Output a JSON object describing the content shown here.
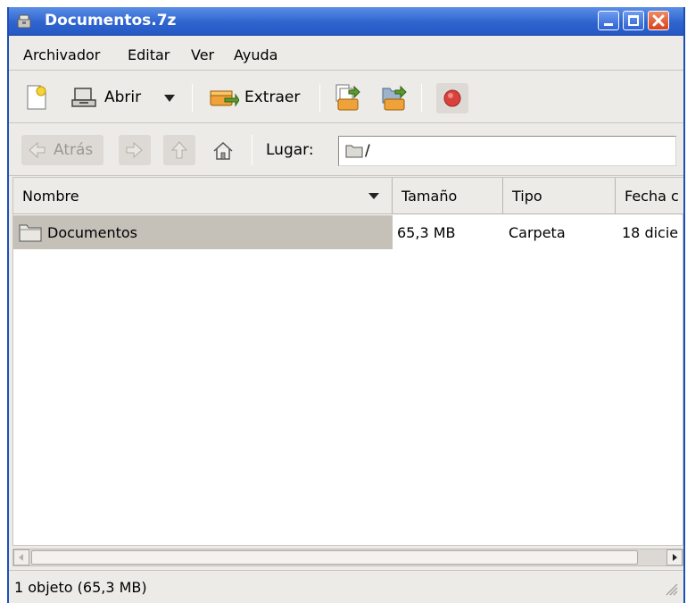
{
  "window": {
    "title": "Documentos.7z",
    "title_icon": "archive-icon",
    "controls": [
      "minimize-icon",
      "maximize-icon",
      "close-icon"
    ]
  },
  "menubar": {
    "items": [
      "Archivador",
      "Editar",
      "Ver",
      "Ayuda"
    ]
  },
  "toolbar": {
    "new_icon": "new-archive-icon",
    "open_label": "Abrir",
    "open_icon": "open-archive-icon",
    "extract_label": "Extraer",
    "extract_icon": "extract-icon",
    "add_files_icon": "add-files-icon",
    "add_folder_icon": "add-folder-icon",
    "stop_icon": "stop-icon"
  },
  "locationbar": {
    "back_label": "Atrás",
    "location_label": "Lugar:",
    "location_value": "/"
  },
  "table": {
    "columns": [
      "Nombre",
      "Tamaño",
      "Tipo",
      "Fecha c"
    ],
    "rows": [
      {
        "name": "Documentos",
        "size": "65,3 MB",
        "type": "Carpeta",
        "date": "18 dicie"
      }
    ]
  },
  "statusbar": {
    "text": "1 objeto (65,3 MB)"
  },
  "colors": {
    "titlebar": "#2f64cf",
    "selection": "#c5c0b8",
    "stop": "#d9413c"
  }
}
